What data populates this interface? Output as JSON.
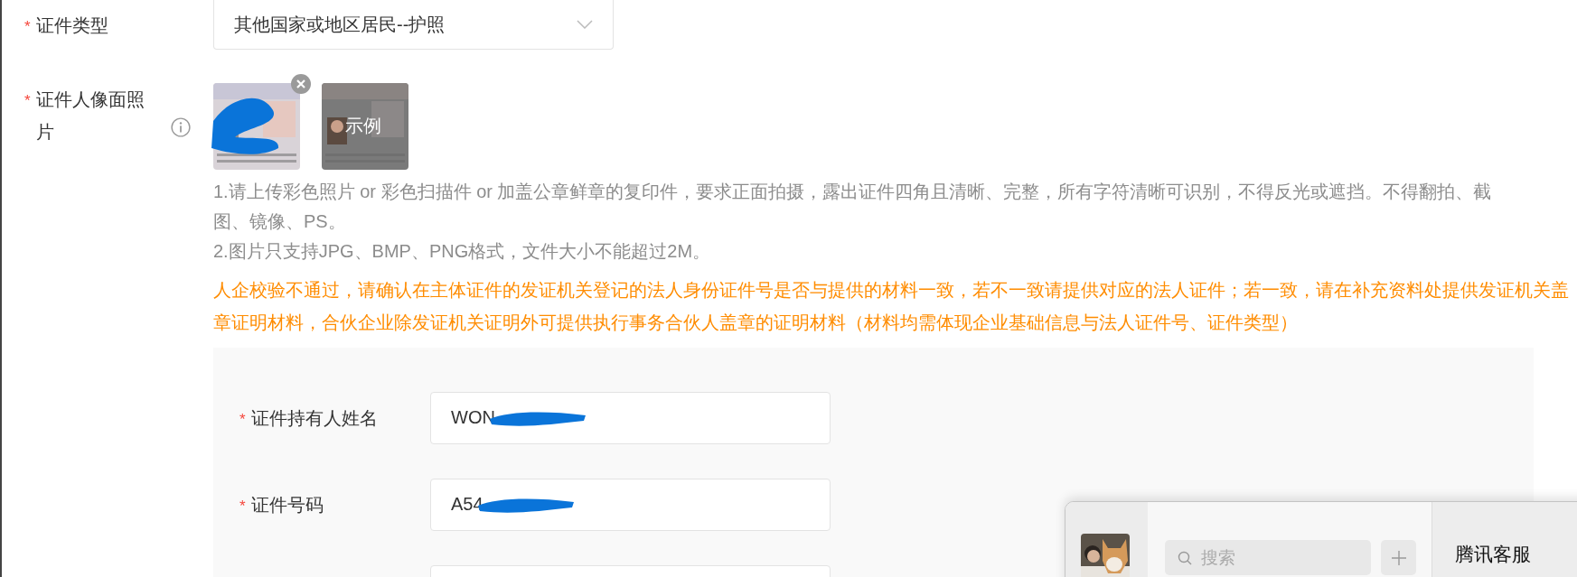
{
  "form": {
    "fields": [
      {
        "kind": "select",
        "label": "证件类型",
        "required_mark": "*",
        "value": "其他国家或地区居民--护照"
      },
      {
        "kind": "upload",
        "label": "证件人像面照片",
        "required_mark": "*",
        "info": true,
        "images": [
          {
            "removable": true,
            "redacted": true
          },
          {
            "caption": "示例"
          }
        ]
      }
    ],
    "hints": [
      "1.请上传彩色照片 or 彩色扫描件 or 加盖公章鲜章的复印件，要求正面拍摄，露出证件四角且清晰、完整，所有字符清晰可识别，不得反光或遮挡。不得翻拍、截图、镜像、PS。",
      "2.图片只支持JPG、BMP、PNG格式，文件大小不能超过2M。"
    ],
    "warning": "人企校验不通过，请确认在主体证件的发证机关登记的法人身份证件号是否与提供的材料一致，若不一致请提供对应的法人证件；若一致，请在补充资料处提供发证机关盖章证明材料，合伙企业除发证机关证明外可提供执行事务合伙人盖章的证明材料（材料均需体现企业基础信息与法人证件号、证件类型）",
    "panel": {
      "fields": [
        {
          "kind": "text",
          "label": "证件持有人姓名",
          "required_mark": "*",
          "value": "WON",
          "redacted": true
        },
        {
          "kind": "text",
          "label": "证件号码",
          "required_mark": "*",
          "value": "A54",
          "redacted": true
        },
        {
          "kind": "cut"
        }
      ]
    }
  },
  "chat_window": {
    "search": {
      "placeholder": "搜索"
    },
    "title": "腾讯客服"
  }
}
